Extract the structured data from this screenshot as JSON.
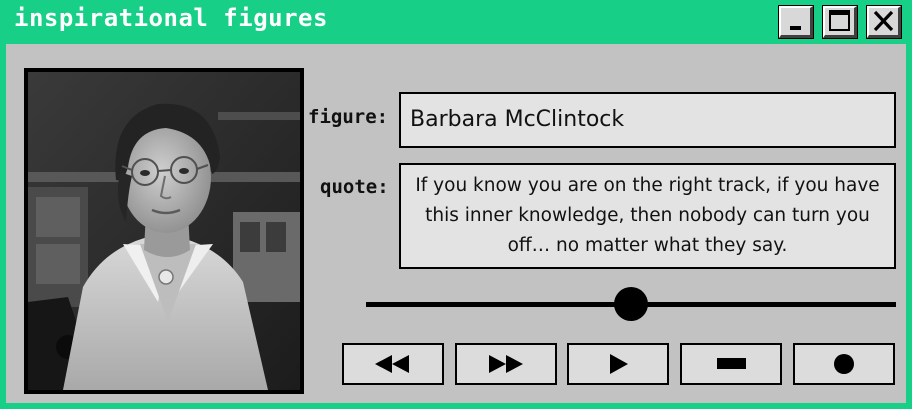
{
  "window": {
    "title": "inspirational figures"
  },
  "title_buttons": [
    {
      "name": "minimize-button",
      "icon": "minimize-icon"
    },
    {
      "name": "maximize-button",
      "icon": "maximize-icon"
    },
    {
      "name": "close-button",
      "icon": "close-icon"
    }
  ],
  "photo": {
    "alt": "Black and white portrait photograph of a woman with short hair and round glasses",
    "icon": "portrait-photo"
  },
  "figure": {
    "label": "figure:",
    "value": "Barbara McClintock"
  },
  "quote": {
    "label": "quote:",
    "value": "If you know you are on the right track, if you have this inner knowledge, then nobody can turn you off… no matter what they say."
  },
  "progress": {
    "fraction": 0.5
  },
  "controls": [
    {
      "name": "rewind-button",
      "icon": "rewind-icon"
    },
    {
      "name": "fast-forward-button",
      "icon": "fast-forward-icon"
    },
    {
      "name": "play-button",
      "icon": "play-icon"
    },
    {
      "name": "stop-button",
      "icon": "stop-icon"
    },
    {
      "name": "record-button",
      "icon": "record-icon"
    }
  ],
  "colors": {
    "frame": "#17cf86",
    "panel": "#c2c2c2",
    "field": "#e3e3e3"
  }
}
